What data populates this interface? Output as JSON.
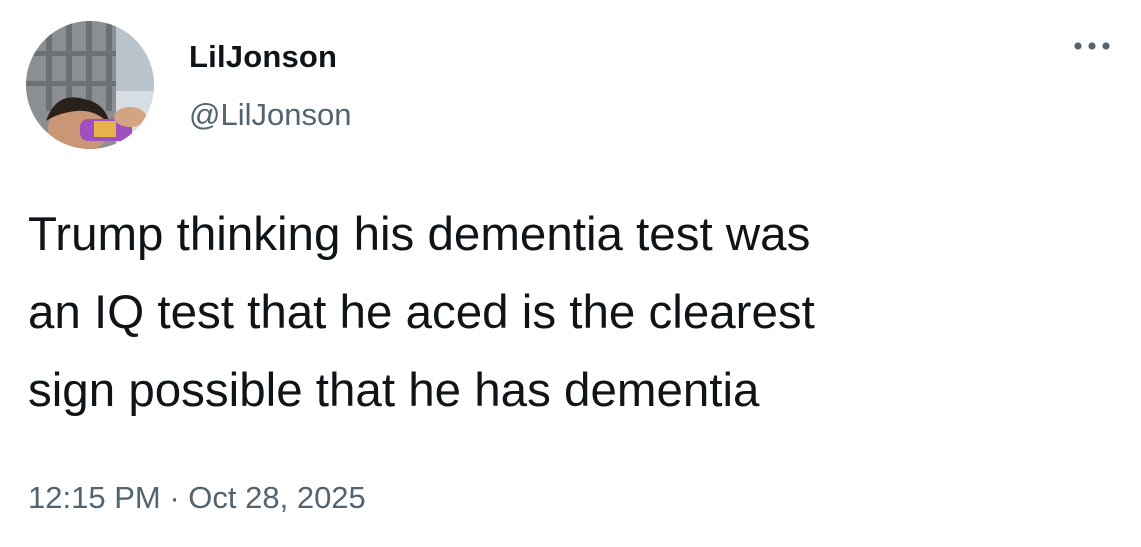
{
  "author": {
    "display_name": "LilJonson",
    "handle": "@LilJonson",
    "avatar_icon": "profile-photo"
  },
  "menu": {
    "icon": "more-horizontal-icon"
  },
  "tweet": {
    "text": "Trump thinking his dementia test was\nan IQ test that he aced is the clearest\nsign possible that he has dementia",
    "time": "12:15 PM",
    "separator": "·",
    "date": "Oct 28, 2025"
  },
  "colors": {
    "primary_text": "#0f1419",
    "secondary_text": "#536471",
    "background": "#ffffff"
  }
}
